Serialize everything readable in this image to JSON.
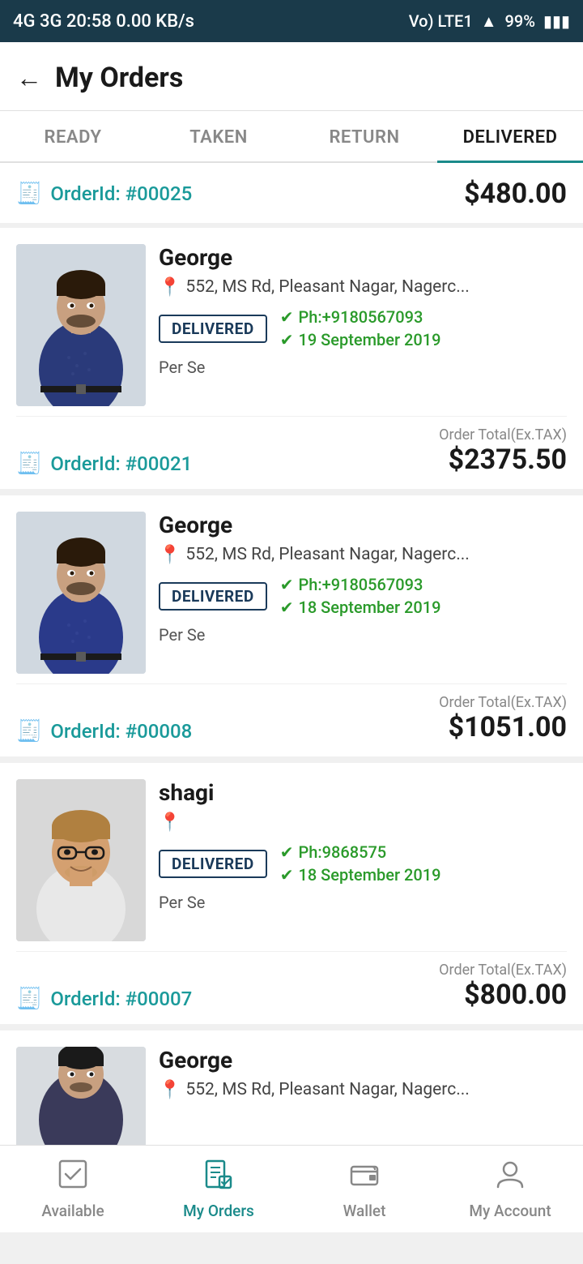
{
  "statusBar": {
    "leftText": "4G 3G  20:58  0.00 KB/s",
    "signal": "VoLTE1",
    "wifi": "WiFi",
    "battery": "99%"
  },
  "header": {
    "backLabel": "←",
    "title": "My Orders"
  },
  "tabs": [
    {
      "id": "ready",
      "label": "READY",
      "active": false
    },
    {
      "id": "taken",
      "label": "TAKEN",
      "active": false
    },
    {
      "id": "return",
      "label": "RETURN",
      "active": false
    },
    {
      "id": "delivered",
      "label": "DELIVERED",
      "active": true
    }
  ],
  "topOrder": {
    "orderId": "OrderId: #00025",
    "amount": "$480.00"
  },
  "orders": [
    {
      "name": "George",
      "address": "552, MS Rd, Pleasant Nagar, Nagerc...",
      "status": "DELIVERED",
      "phone": "Ph:+9180567093",
      "date": "19 September 2019",
      "deliveredBy": "Per Se",
      "orderId": "OrderId: #00021",
      "totalLabel": "Order Total(Ex.TAX)",
      "total": "$2375.50"
    },
    {
      "name": "George",
      "address": "552, MS Rd, Pleasant Nagar, Nagerc...",
      "status": "DELIVERED",
      "phone": "Ph:+9180567093",
      "date": "18 September 2019",
      "deliveredBy": "Per Se",
      "orderId": "OrderId: #00008",
      "totalLabel": "Order Total(Ex.TAX)",
      "total": "$1051.00"
    },
    {
      "name": "shagi",
      "address": "",
      "status": "DELIVERED",
      "phone": "Ph:9868575",
      "date": "18 September 2019",
      "deliveredBy": "Per Se",
      "orderId": "OrderId: #00007",
      "totalLabel": "Order Total(Ex.TAX)",
      "total": "$800.00"
    }
  ],
  "partialOrder": {
    "name": "George",
    "address": "552, MS Rd, Pleasant Nagar, Nagerc..."
  },
  "bottomNav": [
    {
      "id": "available",
      "label": "Available",
      "icon": "☑",
      "active": false
    },
    {
      "id": "my-orders",
      "label": "My Orders",
      "icon": "📋",
      "active": true
    },
    {
      "id": "wallet",
      "label": "Wallet",
      "icon": "👜",
      "active": false
    },
    {
      "id": "my-account",
      "label": "My Account",
      "icon": "👤",
      "active": false
    }
  ]
}
